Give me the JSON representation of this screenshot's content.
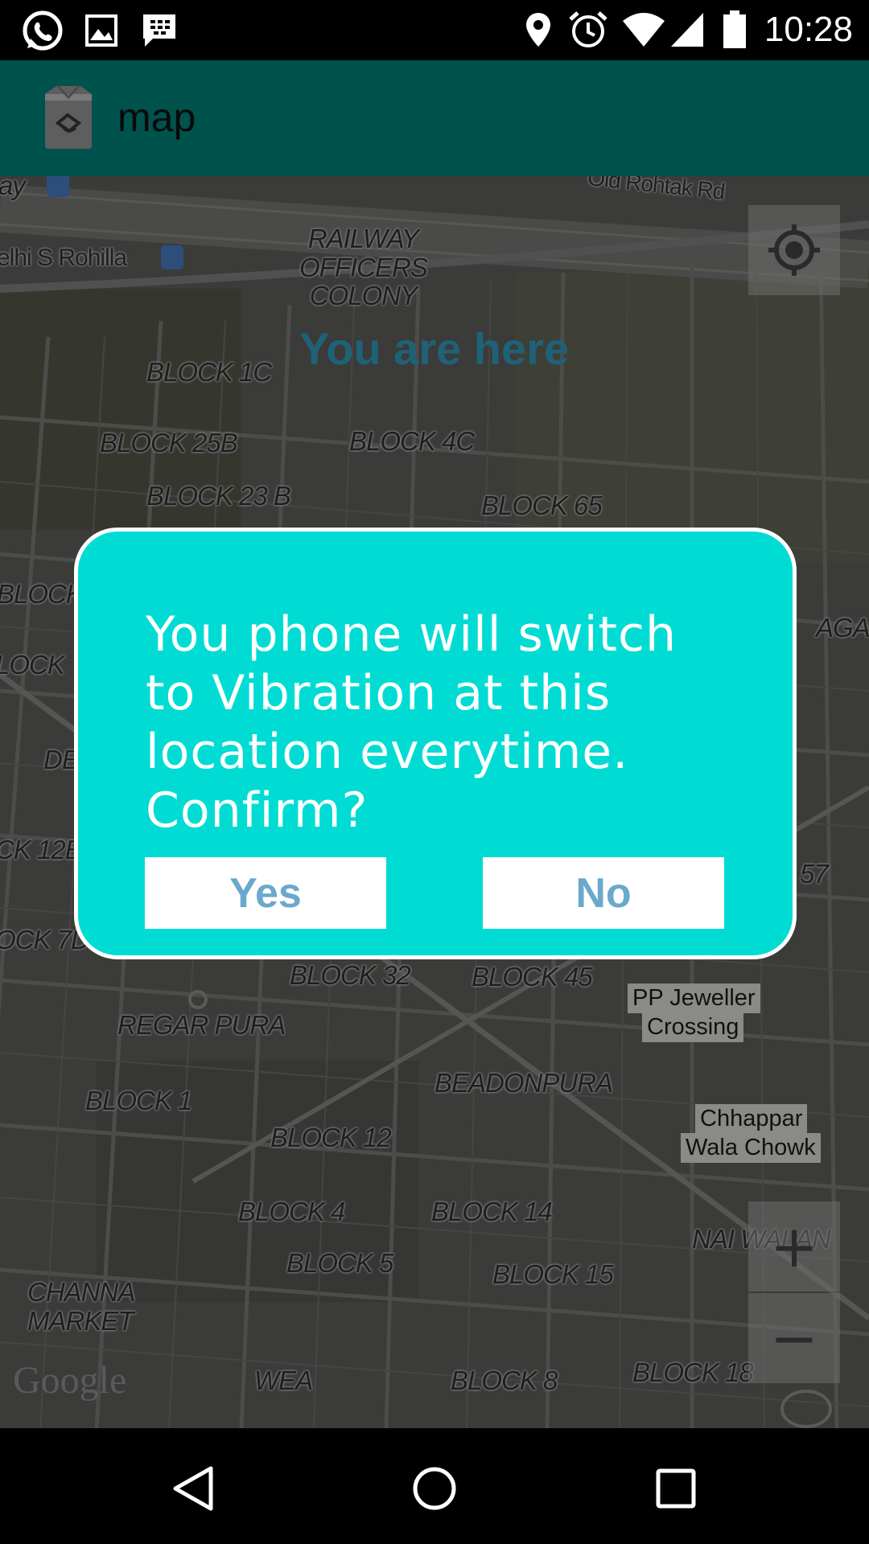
{
  "status_bar": {
    "time": "10:28",
    "left_icons": [
      "whatsapp-icon",
      "gallery-icon",
      "bbm-icon"
    ],
    "right_icons": [
      "location-icon",
      "alarm-icon",
      "wifi-icon",
      "signal-icon",
      "battery-icon"
    ]
  },
  "action_bar": {
    "title": "map",
    "icon": "app-box-icon"
  },
  "map": {
    "you_are_here": "You are here",
    "labels": {
      "way": "ay",
      "delhi_rohilla": "elhi S Rohilla",
      "old_rohtak": "Old Rohtak Rd",
      "railway_officers": "RAILWAY\nOFFICERS\nCOLONY",
      "block_1c": "BLOCK 1C",
      "block_25b": "BLOCK 25B",
      "block_4c": "BLOCK 4C",
      "block_23b": "BLOCK 23 B",
      "block_65": "BLOCK 65",
      "block_left1": "BLOCK",
      "lock_left": "LOCK",
      "de_left": "DE",
      "ck12": "CK 12E",
      "ock7": "OCK 7D",
      "nagar": "AGAR",
      "b57": "57",
      "block_32": "BLOCK 32",
      "block_45": "BLOCK 45",
      "regar_pura": "REGAR PURA",
      "beadonpura": "BEADONPURA",
      "block_1": "BLOCK 1",
      "block_12": "BLOCK 12",
      "block_4": "BLOCK 4",
      "block_14": "BLOCK 14",
      "block_5": "BLOCK 5",
      "block_15": "BLOCK 15",
      "nai_walan": "NAI WALAN",
      "channa_market": "CHANNA\nMARKET",
      "wea": "WEA",
      "block_8": "BLOCK 8",
      "block_18": "BLOCK 18"
    },
    "places": {
      "pp_jeweller_1": "PP Jeweller",
      "pp_jeweller_2": "Crossing",
      "chhappar_1": "Chhappar",
      "chhappar_2": "Wala Chowk"
    },
    "google": "Google",
    "zoom_in": "+",
    "zoom_out": "−"
  },
  "dialog": {
    "message": "You phone will switch to Vibration at this location everytime. Confirm?",
    "yes_label": "Yes",
    "no_label": "No"
  },
  "nav_bar": {
    "icons": [
      "back-icon",
      "home-icon",
      "recents-icon"
    ]
  },
  "colors": {
    "action_bar": "#00524d",
    "dialog_bg": "#00dcd4",
    "button_text": "#6aa9cb",
    "you_are_here": "#1f6277"
  }
}
